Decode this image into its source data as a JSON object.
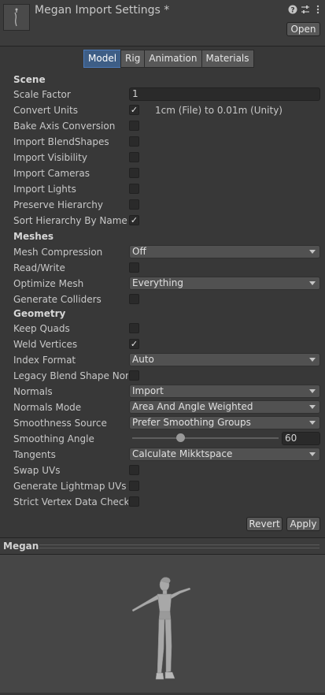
{
  "header": {
    "title": "Megan Import Settings *",
    "open_label": "Open",
    "icons": [
      "help-icon",
      "presets-icon",
      "more-icon"
    ]
  },
  "tabs": [
    {
      "label": "Model",
      "active": true
    },
    {
      "label": "Rig",
      "active": false
    },
    {
      "label": "Animation",
      "active": false
    },
    {
      "label": "Materials",
      "active": false
    }
  ],
  "scene": {
    "heading": "Scene",
    "scale_factor_label": "Scale Factor",
    "scale_factor_value": "1",
    "convert_units_label": "Convert Units",
    "convert_units_checked": true,
    "convert_units_text": "1cm (File) to 0.01m (Unity)",
    "bake_axis_label": "Bake Axis Conversion",
    "import_blendshapes_label": "Import BlendShapes",
    "import_visibility_label": "Import Visibility",
    "import_cameras_label": "Import Cameras",
    "import_lights_label": "Import Lights",
    "preserve_hierarchy_label": "Preserve Hierarchy",
    "sort_hierarchy_label": "Sort Hierarchy By Name",
    "sort_hierarchy_checked": true
  },
  "meshes": {
    "heading": "Meshes",
    "mesh_compression_label": "Mesh Compression",
    "mesh_compression_value": "Off",
    "read_write_label": "Read/Write",
    "optimize_mesh_label": "Optimize Mesh",
    "optimize_mesh_value": "Everything",
    "generate_colliders_label": "Generate Colliders"
  },
  "geometry": {
    "heading": "Geometry",
    "keep_quads_label": "Keep Quads",
    "weld_vertices_label": "Weld Vertices",
    "weld_vertices_checked": true,
    "index_format_label": "Index Format",
    "index_format_value": "Auto",
    "legacy_blend_label": "Legacy Blend Shape Norm",
    "normals_label": "Normals",
    "normals_value": "Import",
    "normals_mode_label": "Normals Mode",
    "normals_mode_value": "Area And Angle Weighted",
    "smoothness_source_label": "Smoothness Source",
    "smoothness_source_value": "Prefer Smoothing Groups",
    "smoothing_angle_label": "Smoothing Angle",
    "smoothing_angle_value": "60",
    "tangents_label": "Tangents",
    "tangents_value": "Calculate Mikktspace",
    "swap_uvs_label": "Swap UVs",
    "lightmap_uvs_label": "Generate Lightmap UVs",
    "strict_vertex_label": "Strict Vertex Data Checks"
  },
  "footer": {
    "revert_label": "Revert",
    "apply_label": "Apply"
  },
  "preview": {
    "title": "Megan"
  },
  "colors": {
    "background": "#383838",
    "tab_active": "#3e5e86",
    "preview_background": "#464646"
  }
}
